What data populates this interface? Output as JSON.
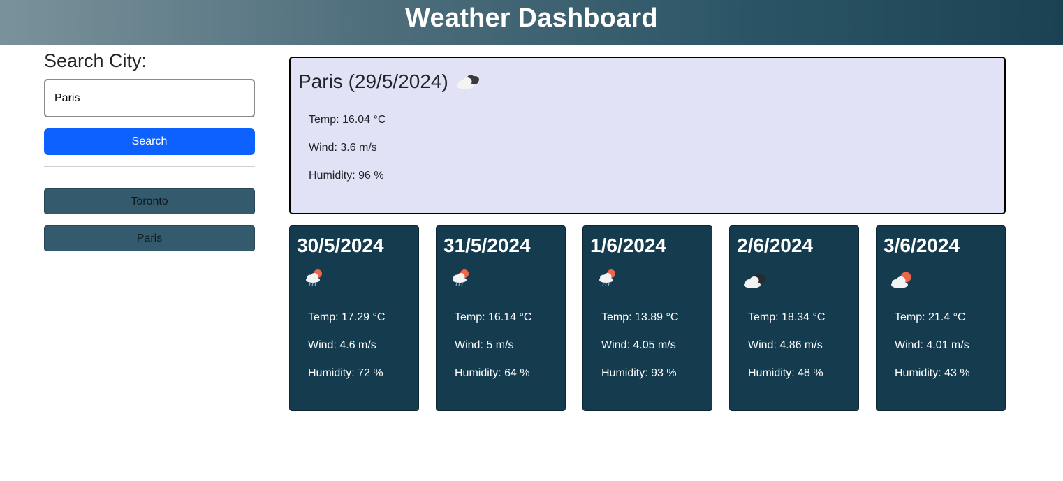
{
  "header": {
    "title": "Weather Dashboard"
  },
  "search": {
    "label": "Search City:",
    "value": "Paris",
    "button_label": "Search"
  },
  "history": [
    {
      "label": "Toronto"
    },
    {
      "label": "Paris"
    }
  ],
  "current": {
    "title": "Paris (29/5/2024)",
    "icon": "cloudy-icon",
    "temp": "Temp: 16.04 °C",
    "wind": "Wind: 3.6 m/s",
    "humidity": "Humidity: 96 %"
  },
  "forecast": [
    {
      "date": "30/5/2024",
      "icon": "sun-behind-rain-cloud-icon",
      "temp": "Temp: 17.29 °C",
      "wind": "Wind: 4.6 m/s",
      "humidity": "Humidity: 72 %"
    },
    {
      "date": "31/5/2024",
      "icon": "sun-behind-rain-cloud-icon",
      "temp": "Temp: 16.14 °C",
      "wind": "Wind: 5 m/s",
      "humidity": "Humidity: 64 %"
    },
    {
      "date": "1/6/2024",
      "icon": "sun-behind-rain-cloud-icon",
      "temp": "Temp: 13.89 °C",
      "wind": "Wind: 4.05 m/s",
      "humidity": "Humidity: 93 %"
    },
    {
      "date": "2/6/2024",
      "icon": "cloudy-icon",
      "temp": "Temp: 18.34 °C",
      "wind": "Wind: 4.86 m/s",
      "humidity": "Humidity: 48 %"
    },
    {
      "date": "3/6/2024",
      "icon": "sun-behind-cloud-icon",
      "temp": "Temp: 21.4 °C",
      "wind": "Wind: 4.01 m/s",
      "humidity": "Humidity: 43 %"
    }
  ],
  "colors": {
    "header_start": "#7a929b",
    "header_end": "#1b4252",
    "search_button": "#0d62ff",
    "history_button": "#345a6d",
    "current_bg": "#e2e2f7",
    "forecast_bg": "#143b4e"
  }
}
